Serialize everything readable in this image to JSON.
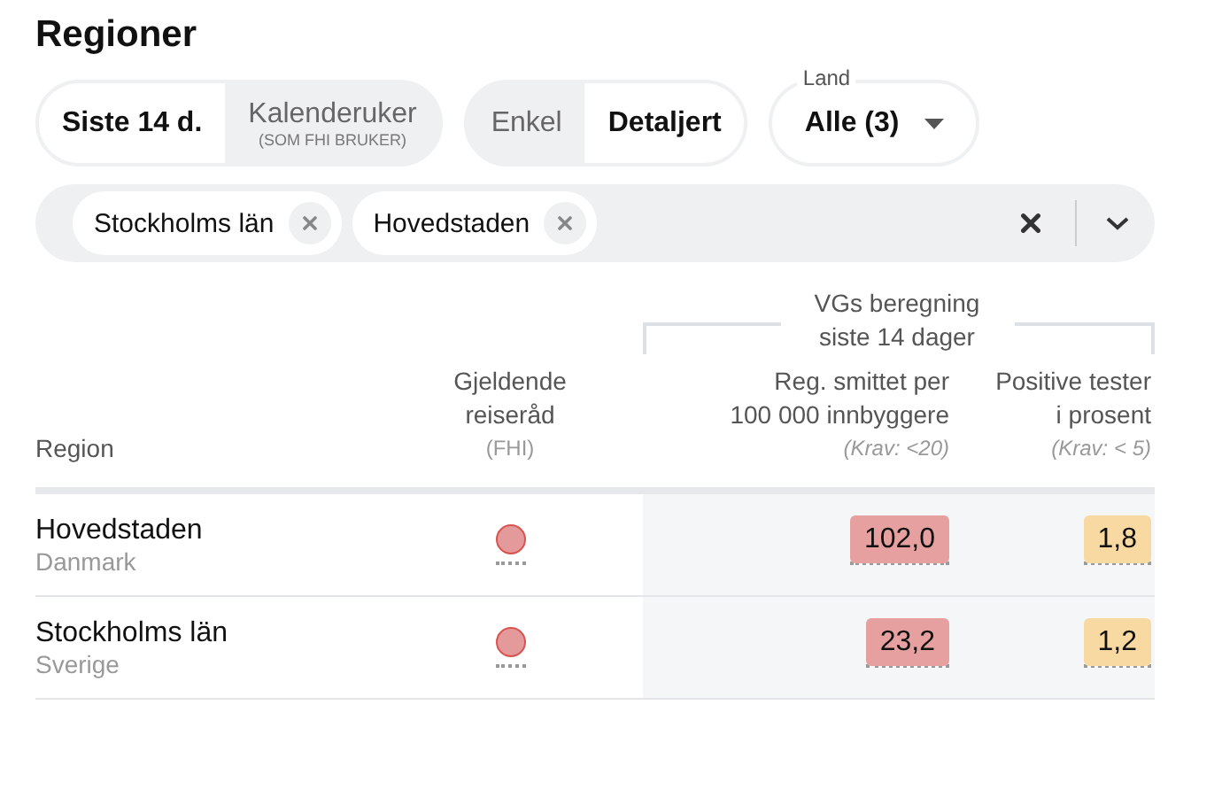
{
  "title": "Regioner",
  "period_toggle": [
    {
      "label": "Siste 14 d.",
      "selected": true
    },
    {
      "label": "Kalenderuker",
      "sublabel": "(SOM FHI BRUKER)",
      "selected": false
    }
  ],
  "detail_toggle": [
    {
      "label": "Enkel",
      "selected": false
    },
    {
      "label": "Detaljert",
      "selected": true
    }
  ],
  "land_select": {
    "label": "Land",
    "value": "Alle (3)"
  },
  "region_filter": {
    "chips": [
      "Stockholms län",
      "Hovedstaden"
    ]
  },
  "table": {
    "group_header": "VGs beregning siste 14 dager",
    "columns": [
      {
        "label": "Region"
      },
      {
        "label": "Gjeldende reiseråd",
        "note": "(FHI)"
      },
      {
        "label": "Reg. smittet per 100 000 innbyggere",
        "note": "(Krav: <20)"
      },
      {
        "label": "Positive tester i prosent",
        "note": "(Krav: < 5)"
      }
    ],
    "rows": [
      {
        "region": "Hovedstaden",
        "country": "Danmark",
        "advice": {
          "color": "#e49a9a"
        },
        "cases": {
          "value": "102,0",
          "color": "#e6a0a0"
        },
        "positive": {
          "value": "1,8",
          "color": "#f9d9a2"
        }
      },
      {
        "region": "Stockholms län",
        "country": "Sverige",
        "advice": {
          "color": "#e49a9a"
        },
        "cases": {
          "value": "23,2",
          "color": "#e6a0a0"
        },
        "positive": {
          "value": "1,2",
          "color": "#f9d9a2"
        }
      }
    ]
  }
}
